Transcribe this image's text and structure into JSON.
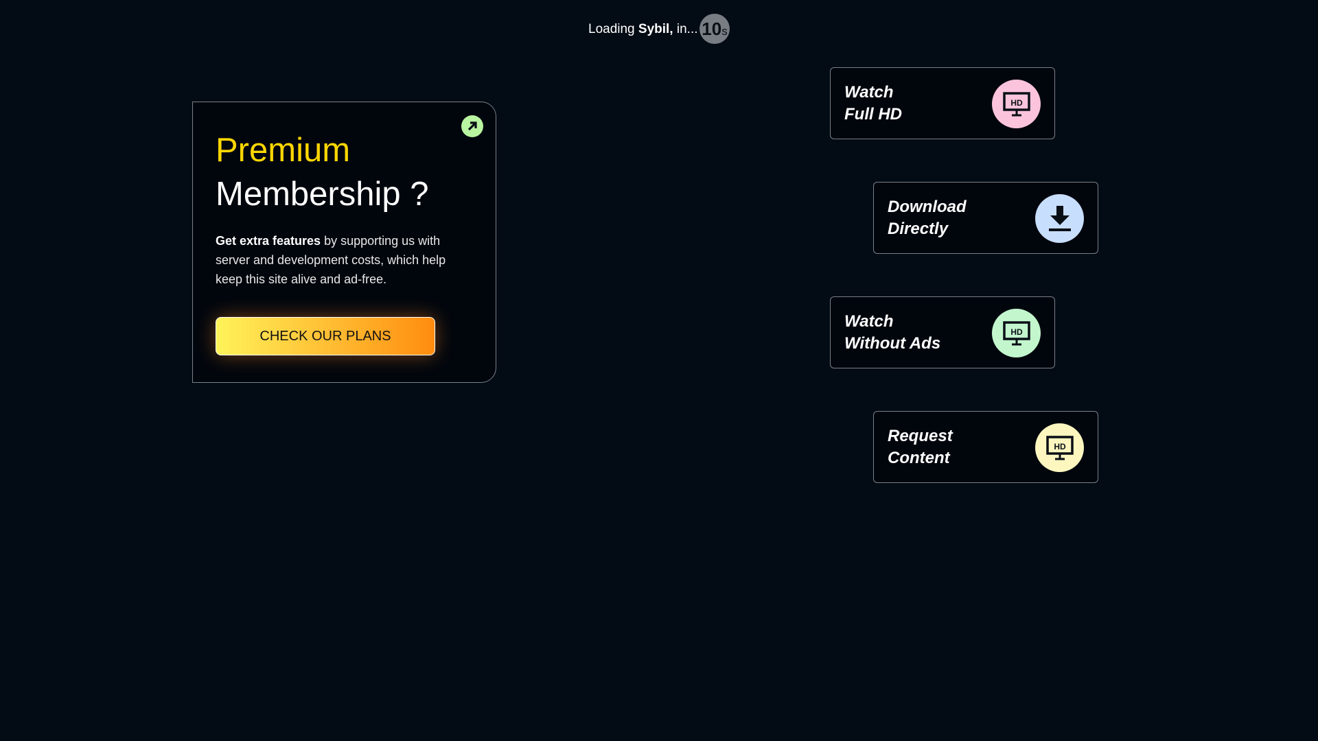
{
  "loading": {
    "prefix": "Loading ",
    "name": "Sybil,",
    "suffix": " in...",
    "count": "10",
    "unit": "s"
  },
  "promo": {
    "title_line1": "Premium",
    "title_line2": "Membership ?",
    "desc_bold": "Get extra features",
    "desc_rest": " by supporting us with server and development costs, which help keep this site alive and ad-free.",
    "cta": "CHECK OUR PLANS"
  },
  "features": [
    {
      "line1": "Watch",
      "line2": "Full HD",
      "icon": "hd-monitor-icon",
      "color": "#fbc4dc"
    },
    {
      "line1": "Download",
      "line2": "Directly",
      "icon": "download-icon",
      "color": "#c8defd"
    },
    {
      "line1": "Watch",
      "line2": "Without Ads",
      "icon": "hd-monitor-icon",
      "color": "#c3f6cd"
    },
    {
      "line1": "Request",
      "line2": "Content",
      "icon": "hd-monitor-icon",
      "color": "#fdf7bf"
    }
  ]
}
